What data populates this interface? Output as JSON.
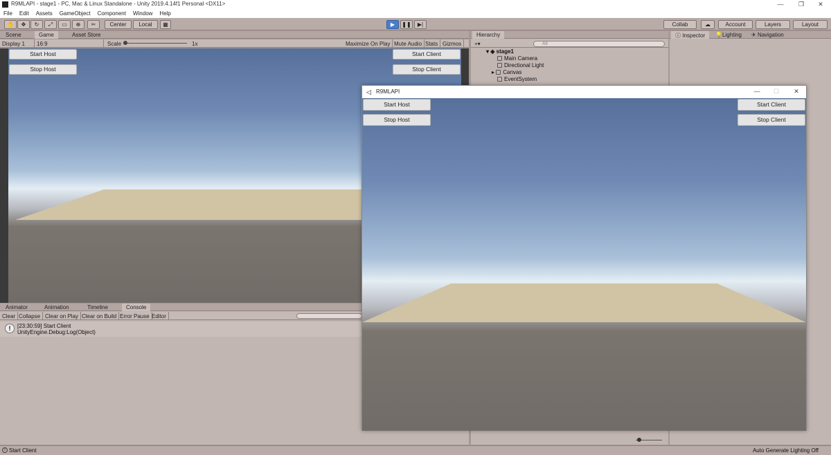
{
  "title_bar": {
    "text": "R9MLAPI - stage1 - PC, Mac & Linux Standalone - Unity 2019.4.14f1 Personal <DX11>",
    "minimize": "—",
    "maximize": "❐",
    "close": "✕"
  },
  "menu": [
    "File",
    "Edit",
    "Assets",
    "GameObject",
    "Component",
    "Window",
    "Help"
  ],
  "toolbar": {
    "tools": [
      "hand-icon",
      "move-icon",
      "rotate-icon",
      "scale-icon",
      "rect-icon",
      "transform-icon",
      "custom-tool-icon"
    ],
    "pivot": "Center",
    "space": "Local",
    "collab": "Collab",
    "account": "Account",
    "layers": "Layers",
    "layout": "Layout"
  },
  "game_view": {
    "tabs": [
      "Scene",
      "Game",
      "Asset Store"
    ],
    "display": "Display 1",
    "aspect": "16:9",
    "scale_label": "Scale",
    "scale_value": "1x",
    "options": [
      "Maximize On Play",
      "Mute Audio",
      "Stats",
      "Gizmos"
    ],
    "buttons": {
      "start_host": "Start Host",
      "stop_host": "Stop Host",
      "start_client": "Start Client",
      "stop_client": "Stop Client"
    }
  },
  "hierarchy": {
    "tab": "Hierarchy",
    "search_placeholder": "All",
    "scene": "stage1",
    "items": [
      "Main Camera",
      "Directional Light",
      "Canvas",
      "EventSystem"
    ]
  },
  "inspector_tabs": [
    "Inspector",
    "Lighting",
    "Navigation"
  ],
  "bottom_tabs": [
    "Animator",
    "Animation",
    "Timeline",
    "Console"
  ],
  "console": {
    "buttons": [
      "Clear",
      "Collapse",
      "Clear on Play",
      "Clear on Build",
      "Error Pause",
      "Editor"
    ],
    "log_line1": "[23:30:59] Start Client",
    "log_line2": "UnityEngine.Debug:Log(Object)"
  },
  "standalone": {
    "title": "R9MLAPI",
    "buttons": {
      "start_host": "Start Host",
      "stop_host": "Stop Host",
      "start_client": "Start Client",
      "stop_client": "Stop Client"
    }
  },
  "status": {
    "message": "Start Client",
    "right": "Auto Generate Lighting Off"
  }
}
